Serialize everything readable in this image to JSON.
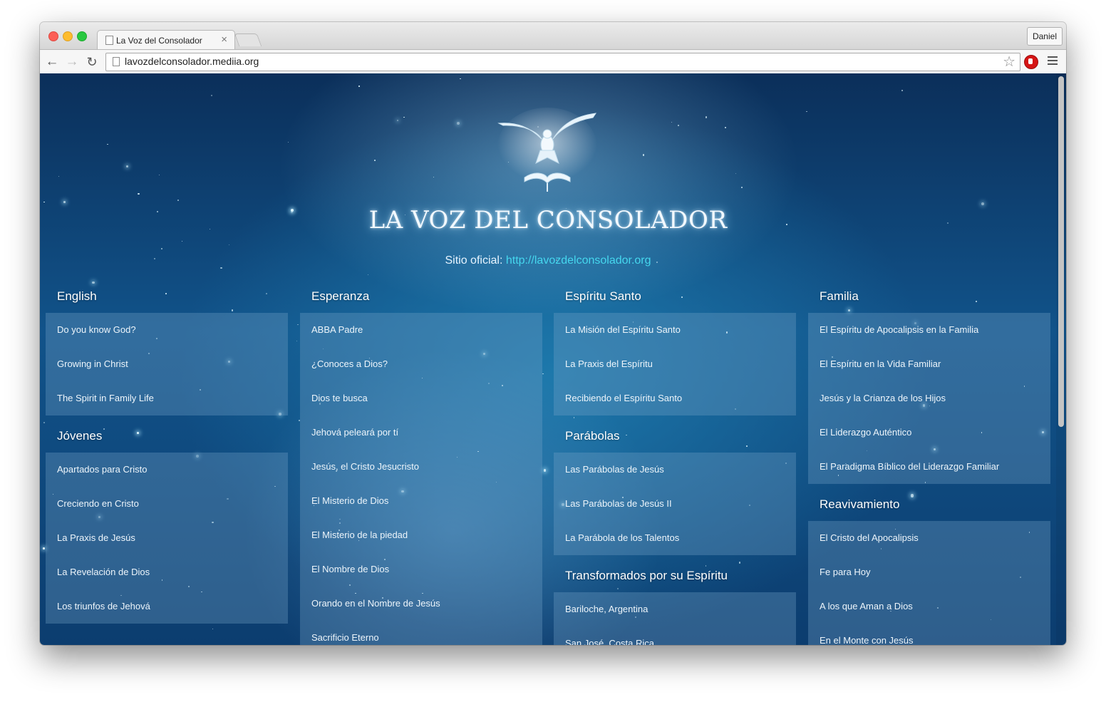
{
  "browser": {
    "tab_title": "La Voz del Consolador",
    "tab_close": "×",
    "profile": "Daniel",
    "url": "lavozdelconsolador.mediia.org",
    "back_glyph": "←",
    "forward_glyph": "→",
    "reload_glyph": "↻",
    "star_glyph": "☆"
  },
  "page": {
    "title": "LA VOZ DEL CONSOLADOR",
    "official_prefix": "Sitio oficial:",
    "official_link": "http://lavozdelconsolador.org"
  },
  "columns": [
    {
      "sections": [
        {
          "title": "English",
          "items": [
            "Do you know God?",
            "Growing in Christ",
            "The Spirit in Family Life"
          ]
        },
        {
          "title": "Jóvenes",
          "items": [
            "Apartados para Cristo",
            "Creciendo en Cristo",
            "La Praxis de Jesús",
            "La Revelación de Dios",
            "Los triunfos de Jehová"
          ]
        }
      ]
    },
    {
      "sections": [
        {
          "title": "Esperanza",
          "items": [
            "ABBA Padre",
            "¿Conoces a Dios?",
            "Dios te busca",
            "Jehová peleará por tí",
            "Jesús, el Cristo Jesucristo",
            "El Misterio de Dios",
            "El Misterio de la piedad",
            "El Nombre de Dios",
            "Orando en el Nombre de Jesús",
            "Sacrificio Eterno"
          ]
        }
      ]
    },
    {
      "sections": [
        {
          "title": "Espíritu Santo",
          "items": [
            "La Misión del Espíritu Santo",
            "La Praxis del Espíritu",
            "Recibiendo el Espíritu Santo"
          ]
        },
        {
          "title": "Parábolas",
          "items": [
            "Las Parábolas de Jesús",
            "Las Parábolas de Jesús II",
            "La Parábola de los Talentos"
          ]
        },
        {
          "title": "Transformados por su Espíritu",
          "items": [
            "Bariloche, Argentina",
            "San José, Costa Rica"
          ]
        }
      ]
    },
    {
      "sections": [
        {
          "title": "Familia",
          "items": [
            "El Espíritu de Apocalipsis en la Familia",
            "El Espíritu en la Vida Familiar",
            "Jesús y la Crianza de los Hijos",
            "El Liderazgo Auténtico",
            "El Paradigma Bíblico del Liderazgo Familiar"
          ]
        },
        {
          "title": "Reavivamiento",
          "items": [
            "El Cristo del Apocalipsis",
            "Fe para Hoy",
            "A los que Aman a Dios",
            "En el Monte con Jesús"
          ]
        }
      ]
    }
  ],
  "icons": {
    "logo": "dove-over-open-bible-logo",
    "page": "page-icon",
    "extension": "stop-hand-extension-icon",
    "menu": "hamburger-menu-icon"
  },
  "colors": {
    "link_accent": "#45d7ee",
    "panel": "rgba(118,163,200,0.33)",
    "background_dark": "#0b2f5a",
    "background_light": "#1d78ab"
  }
}
